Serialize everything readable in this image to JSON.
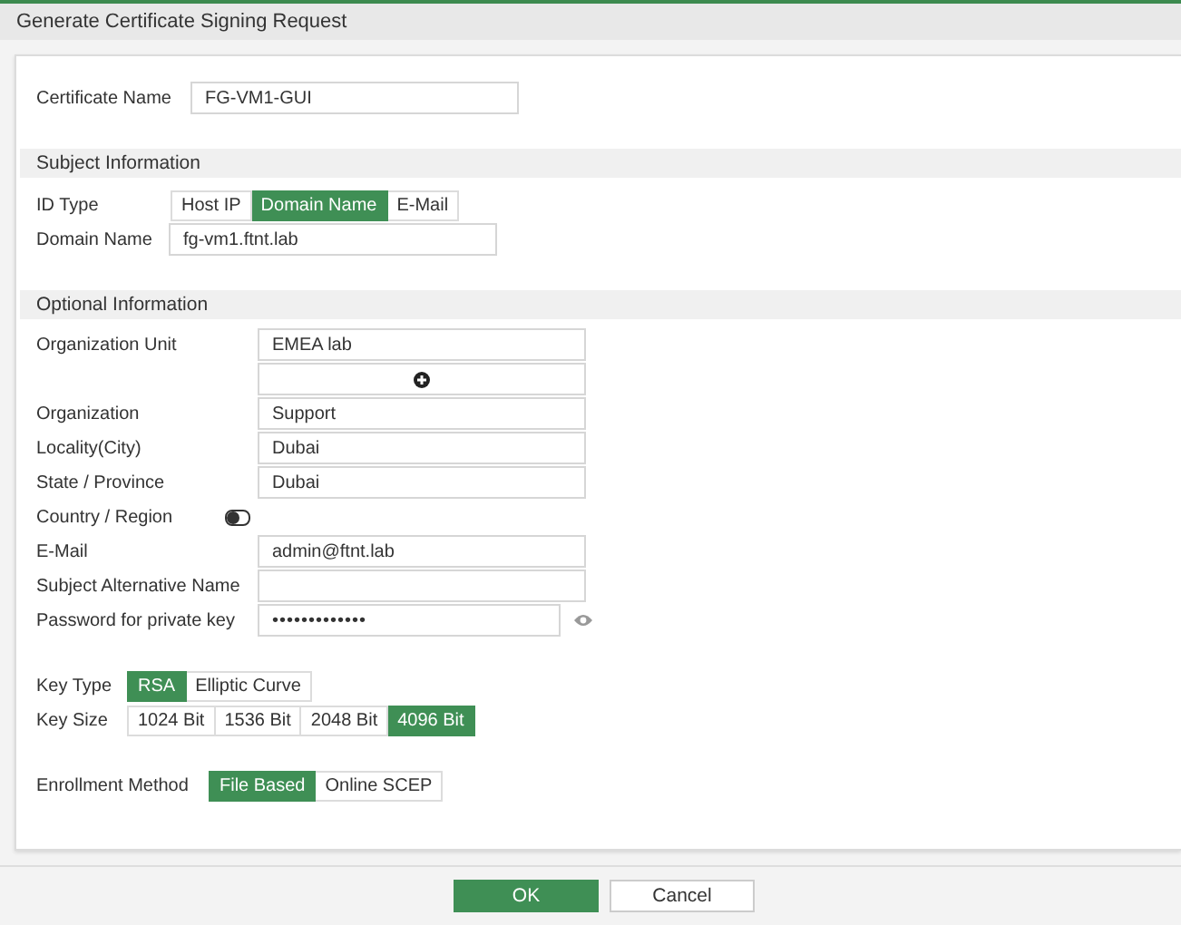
{
  "window": {
    "title": "Generate Certificate Signing Request"
  },
  "certificate_name": {
    "label": "Certificate Name",
    "value": "FG-VM1-GUI"
  },
  "subject_information": {
    "heading": "Subject Information",
    "id_type": {
      "label": "ID Type",
      "options": [
        {
          "label": "Host IP",
          "selected": false
        },
        {
          "label": "Domain Name",
          "selected": true
        },
        {
          "label": "E-Mail",
          "selected": false
        }
      ]
    },
    "domain_name": {
      "label": "Domain Name",
      "value": "fg-vm1.ftnt.lab"
    }
  },
  "optional_information": {
    "heading": "Optional Information",
    "fields": [
      {
        "kind": "text",
        "label": "Organization Unit",
        "value": "EMEA lab"
      },
      {
        "kind": "add"
      },
      {
        "kind": "text",
        "label": "Organization",
        "value": "Support"
      },
      {
        "kind": "text",
        "label": "Locality(City)",
        "value": "Dubai"
      },
      {
        "kind": "text",
        "label": "State / Province",
        "value": "Dubai"
      },
      {
        "kind": "toggle",
        "label": "Country / Region",
        "on": false
      },
      {
        "kind": "text",
        "label": "E-Mail",
        "value": "admin@ftnt.lab"
      },
      {
        "kind": "text",
        "label": "Subject Alternative Name"
      },
      {
        "kind": "password",
        "label": "Password for private key",
        "value": "•••••••••••••"
      }
    ]
  },
  "key_type": {
    "label": "Key Type",
    "options": [
      {
        "label": "RSA",
        "selected": true
      },
      {
        "label": "Elliptic Curve",
        "selected": false
      }
    ]
  },
  "key_size": {
    "label": "Key Size",
    "options": [
      {
        "label": "1024 Bit",
        "selected": false
      },
      {
        "label": "1536 Bit",
        "selected": false
      },
      {
        "label": "2048 Bit",
        "selected": false
      },
      {
        "label": "4096 Bit",
        "selected": true
      }
    ]
  },
  "enrollment_method": {
    "label": "Enrollment Method",
    "options": [
      {
        "label": "File Based",
        "selected": true
      },
      {
        "label": "Online SCEP",
        "selected": false
      }
    ]
  },
  "buttons": [
    {
      "label": "OK",
      "primary": true
    },
    {
      "label": "Cancel",
      "primary": false
    }
  ]
}
